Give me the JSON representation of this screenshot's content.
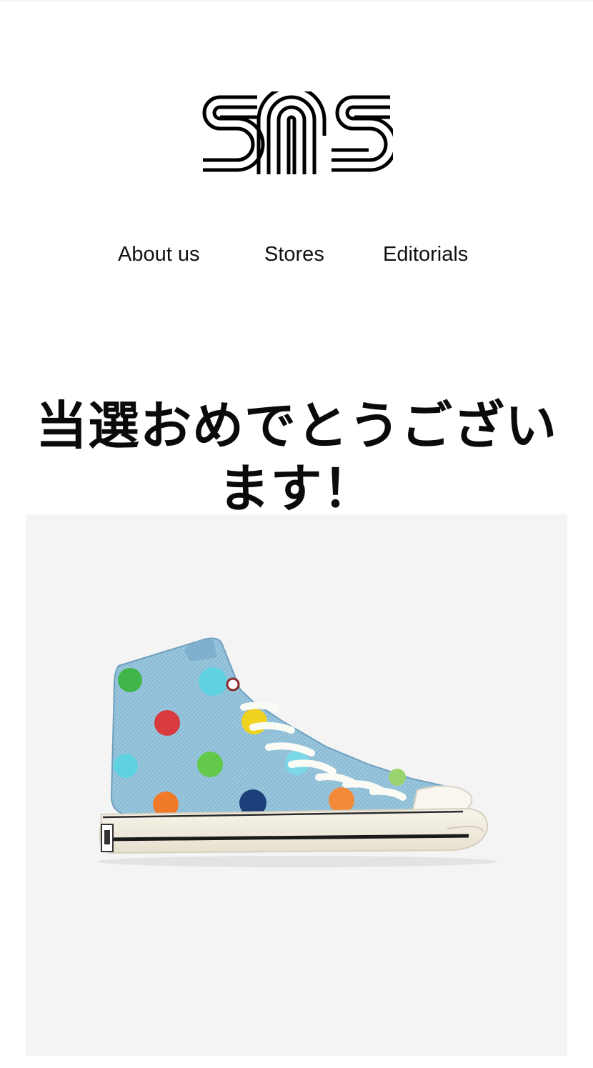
{
  "brand": {
    "logo_text": "sns",
    "logo_icon": "sns-logo-icon"
  },
  "nav": {
    "items": [
      {
        "label": "About us"
      },
      {
        "label": "Stores"
      },
      {
        "label": "Editorials"
      }
    ]
  },
  "headline": "当選おめでとうございます！",
  "product": {
    "image_icon": "polka-dot-high-top-sneaker",
    "background": "#f4f4f4",
    "denim_color": "#8fbfd8",
    "dot_colors": [
      "#e03a3a",
      "#f0d321",
      "#3fb54a",
      "#4ad0e0",
      "#f07a2a",
      "#1c3f7a",
      "#7ad4e8"
    ]
  }
}
